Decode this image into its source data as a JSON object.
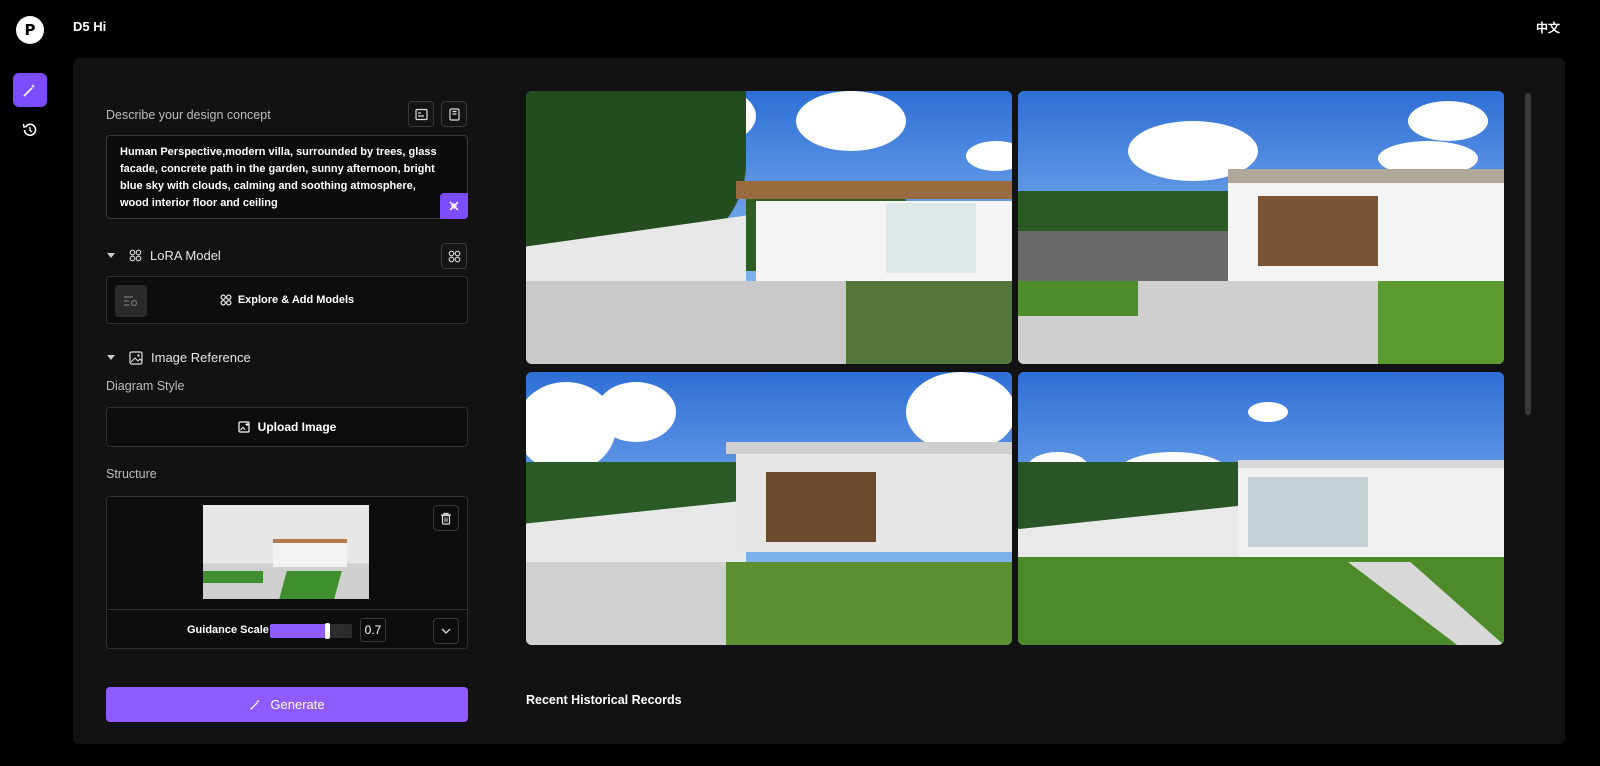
{
  "app": {
    "title": "D5 Hi",
    "logo_letter": "P",
    "language": "中文"
  },
  "rail": {
    "items": [
      {
        "name": "magic-wand"
      },
      {
        "name": "history"
      }
    ]
  },
  "prompt": {
    "label": "Describe your design concept",
    "text": "Human Perspective,modern villa, surrounded by trees, glass facade, concrete path in the garden, sunny afternoon, bright blue sky with clouds, calming and soothing atmosphere, wood interior floor and ceiling"
  },
  "lora": {
    "label": "LoRA Model",
    "explore_label": "Explore & Add Models"
  },
  "image_reference": {
    "label": "Image Reference",
    "diagram_style_label": "Diagram Style",
    "upload_label": "Upload Image",
    "structure_label": "Structure",
    "guidance_label": "Guidance Scale",
    "guidance_value": "0.7",
    "guidance_fraction": 0.7
  },
  "generate_label": "Generate",
  "recent_label": "Recent Historical Records",
  "accent_color": "#8e5bff"
}
